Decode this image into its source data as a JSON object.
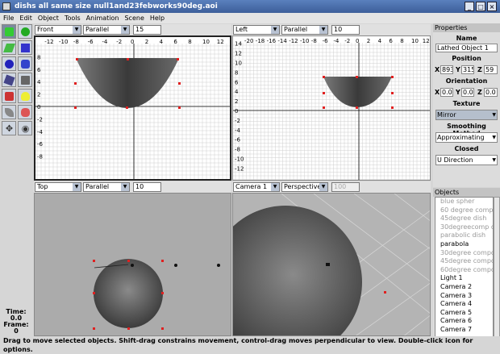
{
  "window": {
    "title": "dishs all same size null1and23febworks90deg.aoi",
    "min": "_",
    "max": "□",
    "close": "×"
  },
  "menu": [
    "File",
    "Edit",
    "Object",
    "Tools",
    "Animation",
    "Scene",
    "Help"
  ],
  "viewports": {
    "front": {
      "view": "Front",
      "projection": "Parallel",
      "scale": "15"
    },
    "left": {
      "view": "Left",
      "projection": "Parallel",
      "scale": "10"
    },
    "top": {
      "view": "Top",
      "projection": "Parallel",
      "scale": "10"
    },
    "camera": {
      "view": "Camera 1",
      "projection": "Perspective",
      "scale": "100"
    }
  },
  "rulers": {
    "front_x": [
      "-12",
      "-10",
      "-8",
      "-6",
      "-4",
      "-2",
      "0",
      "2",
      "4",
      "6",
      "8",
      "10",
      "12"
    ],
    "front_y": [
      "8",
      "6",
      "4",
      "2",
      "0",
      "-2",
      "-4",
      "-6",
      "-8"
    ],
    "left_x": [
      "-20",
      "-18",
      "-16",
      "-14",
      "-12",
      "-10",
      "-8",
      "-6",
      "-4",
      "-2",
      "0",
      "2",
      "4",
      "6",
      "8",
      "10",
      "12"
    ],
    "left_y": [
      "14",
      "12",
      "10",
      "8",
      "6",
      "4",
      "2",
      "0",
      "-2",
      "-4",
      "-6",
      "-8",
      "-10",
      "-12"
    ]
  },
  "timeinfo": {
    "time_label": "Time:",
    "time": "0.0",
    "frame_label": "Frame:",
    "frame": "0"
  },
  "properties": {
    "title": "Properties",
    "name_label": "Name",
    "name": "Lathed Object 1",
    "position_label": "Position",
    "pos_x": "893",
    "pos_y": "315",
    "pos_z": "59",
    "orientation_label": "Orientation",
    "or_x": "0.0",
    "or_y": "0.0",
    "or_z": "0.0",
    "texture_label": "Texture",
    "texture": "Mirror",
    "smoothing_label": "Smoothing Method",
    "smoothing": "Approximating",
    "closed_label": "Closed",
    "closed": "U Direction",
    "x": "X",
    "y": "Y",
    "z": "Z"
  },
  "objects": {
    "title": "Objects",
    "items": [
      {
        "label": "blue spher",
        "dim": true
      },
      {
        "label": "60 degree compo",
        "dim": true
      },
      {
        "label": "45degree dish",
        "dim": true
      },
      {
        "label": "30degreecomp di",
        "dim": true
      },
      {
        "label": "parabolic dish",
        "dim": true
      },
      {
        "label": "parabola",
        "dim": false
      },
      {
        "label": "30degree compo",
        "dim": true
      },
      {
        "label": "45degree compou",
        "dim": true
      },
      {
        "label": "60degree compo",
        "dim": true
      },
      {
        "label": "Light 1",
        "dim": false
      },
      {
        "label": "Camera 2",
        "dim": false
      },
      {
        "label": "Camera 3",
        "dim": false
      },
      {
        "label": "Camera 4",
        "dim": false
      },
      {
        "label": "Camera 5",
        "dim": false
      },
      {
        "label": "Camera 6",
        "dim": false
      },
      {
        "label": "Camera 7",
        "dim": false
      }
    ]
  },
  "status": "Drag to move selected objects.  Shift-drag constrains movement, control-drag moves perpendicular to view.  Double-click icon for options.",
  "colors": {
    "title": "#3d5f9a",
    "grid": "#c8c8c8",
    "handle": "#e02020",
    "selected_tool": "#7c8a9f"
  }
}
